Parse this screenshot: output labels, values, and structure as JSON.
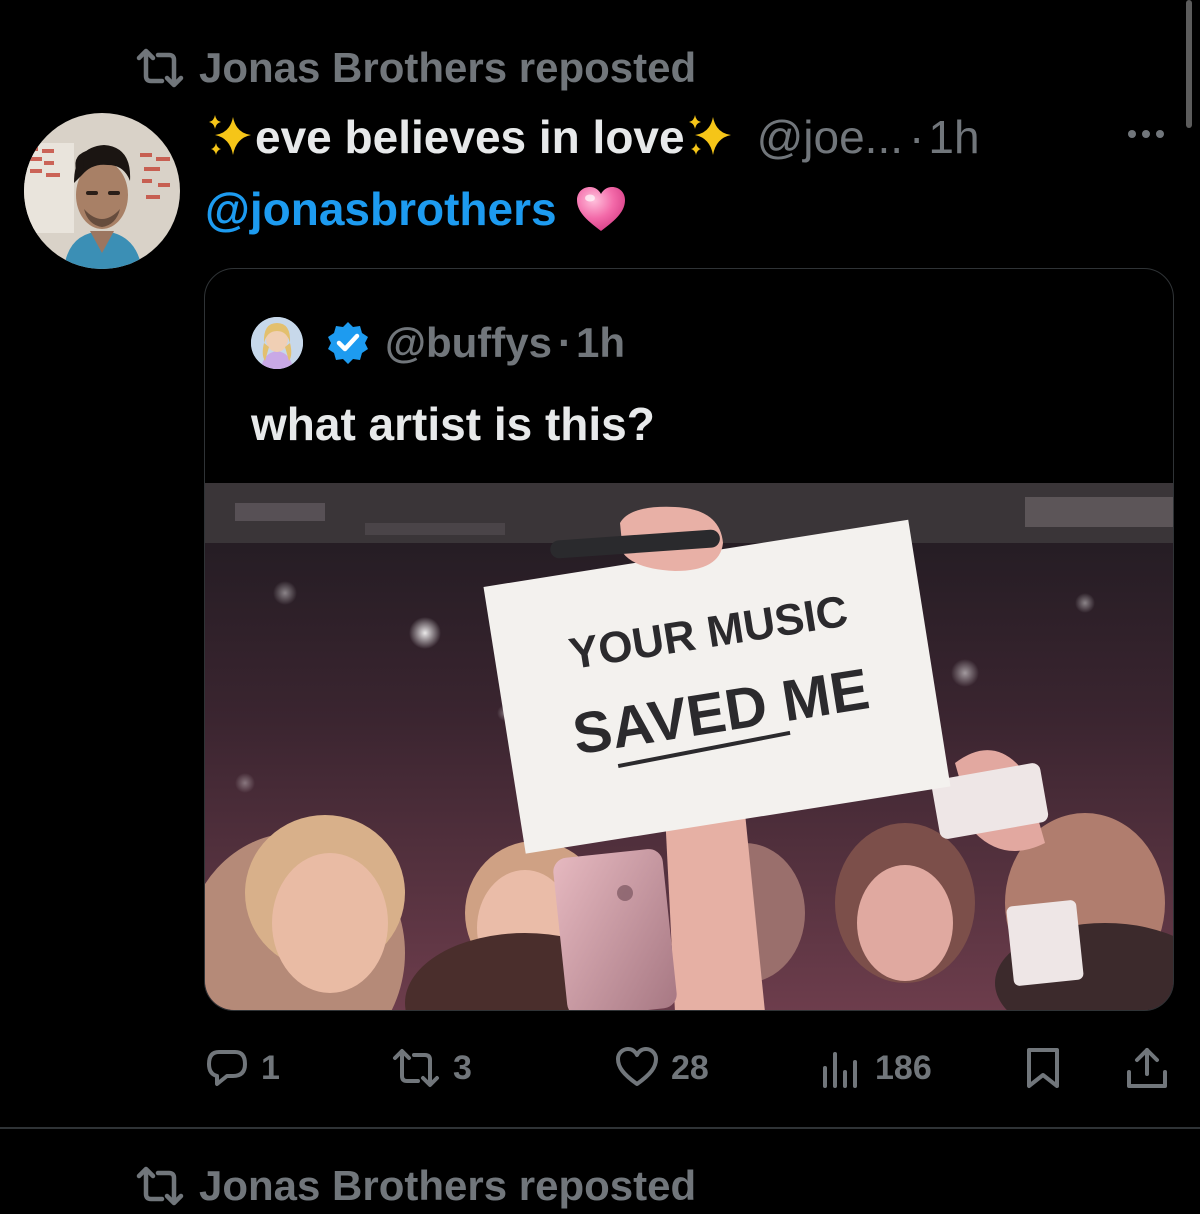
{
  "repost_banner": {
    "text": "Jonas Brothers reposted"
  },
  "post": {
    "display_name": "eve believes in love",
    "handle": "@joe...",
    "separator": "·",
    "time": "1h",
    "mention": "@jonasbrothers",
    "emoji": "heart-emoji"
  },
  "quote": {
    "handle": "@buffys",
    "separator": "·",
    "time": "1h",
    "text": "what artist is this?",
    "media": {
      "sign_line_1": "YOUR MUSIC",
      "sign_line_2": "SAVED ME"
    }
  },
  "actions": {
    "reply_count": "1",
    "repost_count": "3",
    "like_count": "28",
    "views_count": "186"
  },
  "next_post": {
    "repost_banner": "Jonas Brothers reposted"
  },
  "colors": {
    "background": "#000000",
    "text": "#e7e9ea",
    "muted": "#71767b",
    "link": "#1d9bf0",
    "border": "#2f3336",
    "verified": "#1d9bf0"
  }
}
